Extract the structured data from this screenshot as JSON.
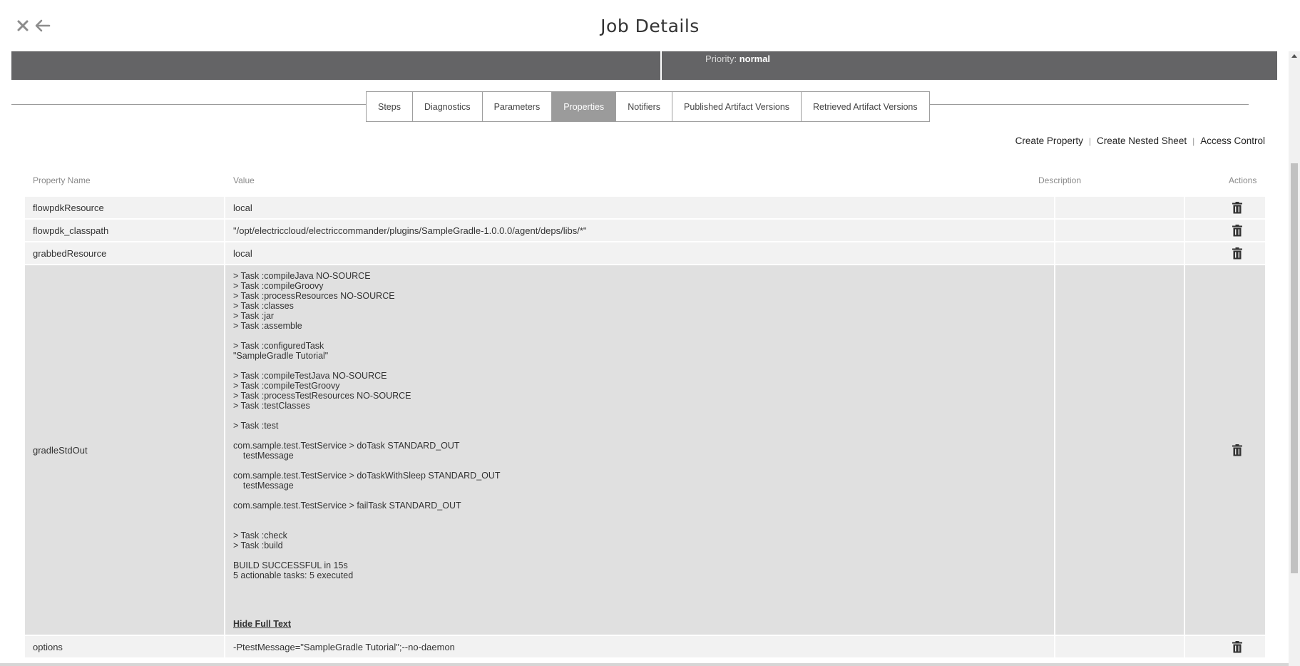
{
  "header": {
    "title": "Job Details"
  },
  "summary": {
    "priority_label": "Priority:",
    "priority_value": "normal"
  },
  "tabs": [
    {
      "label": "Steps",
      "active": false
    },
    {
      "label": "Diagnostics",
      "active": false
    },
    {
      "label": "Parameters",
      "active": false
    },
    {
      "label": "Properties",
      "active": true
    },
    {
      "label": "Notifiers",
      "active": false
    },
    {
      "label": "Published Artifact Versions",
      "active": false
    },
    {
      "label": "Retrieved Artifact Versions",
      "active": false
    }
  ],
  "toolbar": {
    "create_property": "Create Property",
    "create_nested_sheet": "Create Nested Sheet",
    "access_control": "Access Control",
    "separator": "|"
  },
  "table": {
    "headers": {
      "name": "Property Name",
      "value": "Value",
      "description": "Description",
      "actions": "Actions"
    },
    "rows": [
      {
        "name": "flowpdkResource",
        "value": "local",
        "description": ""
      },
      {
        "name": "flowpdk_classpath",
        "value": "\"/opt/electriccloud/electriccommander/plugins/SampleGradle-1.0.0.0/agent/deps/libs/*\"",
        "description": ""
      },
      {
        "name": "grabbedResource",
        "value": "local",
        "description": ""
      },
      {
        "name": "gradleStdOut",
        "value": "> Task :compileJava NO-SOURCE\n> Task :compileGroovy\n> Task :processResources NO-SOURCE\n> Task :classes\n> Task :jar\n> Task :assemble\n\n> Task :configuredTask\n\"SampleGradle Tutorial\"\n\n> Task :compileTestJava NO-SOURCE\n> Task :compileTestGroovy\n> Task :processTestResources NO-SOURCE\n> Task :testClasses\n\n> Task :test\n\ncom.sample.test.TestService > doTask STANDARD_OUT\n    testMessage\n\ncom.sample.test.TestService > doTaskWithSleep STANDARD_OUT\n    testMessage\n\ncom.sample.test.TestService > failTask STANDARD_OUT\n\n\n> Task :check\n> Task :build\n\nBUILD SUCCESSFUL in 15s\n5 actionable tasks: 5 executed",
        "description": "",
        "hide_link": "Hide Full Text"
      },
      {
        "name": "options",
        "value": "-PtestMessage=\"SampleGradle Tutorial\";--no-daemon",
        "description": ""
      }
    ]
  },
  "icons": {
    "close": "close-icon",
    "back": "back-arrow-icon",
    "delete": "trash-icon"
  }
}
